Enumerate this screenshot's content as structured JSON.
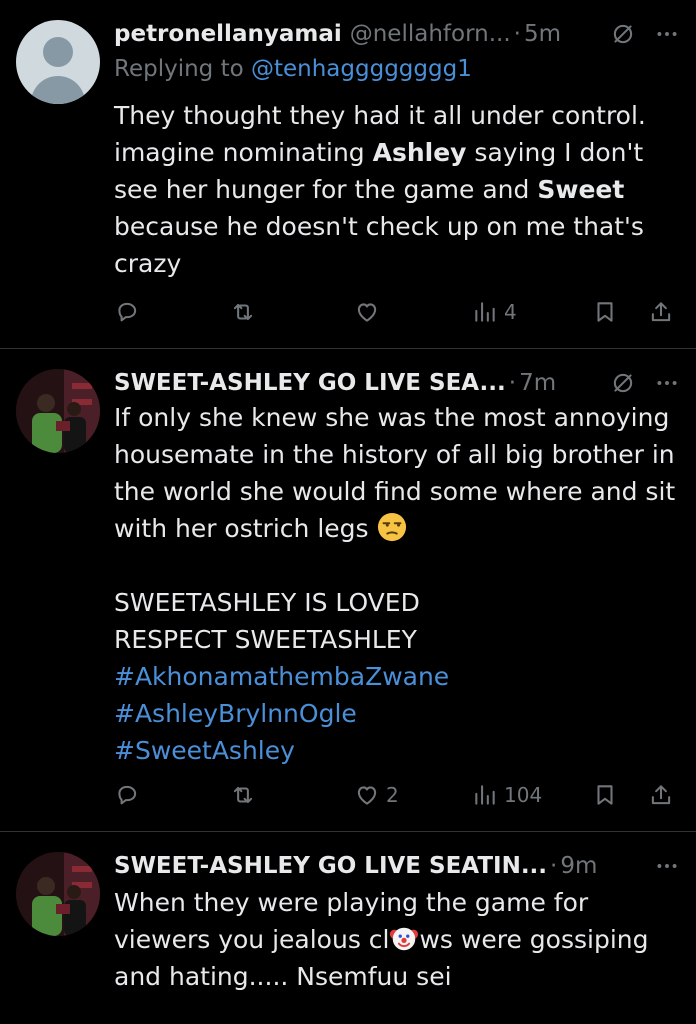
{
  "tweets": [
    {
      "name": "petronellanyamai",
      "handle": "@nellahforn...",
      "time": "5m",
      "reply_prefix": "Replying to",
      "reply_to": "@tenhagggggggg1",
      "lines": [
        {
          "a": "They thought they had it all under control."
        },
        {
          "a": "imagine nominating ",
          "b": "Ashley",
          "c": " saying I don't"
        },
        {
          "a": "see her hunger for the game and ",
          "b": "Sweet"
        },
        {
          "a": "because he doesn't check up on me that's"
        },
        {
          "a": "crazy"
        }
      ],
      "likes": "",
      "views": "4"
    },
    {
      "name": "SWEET-ASHLEY GO LIVE SEA...",
      "time": "7m",
      "lines": [
        "If only she knew she was the most annoying",
        "housemate in the history of all big brother in",
        "the world she would find some where and sit",
        "with her ostrich legs"
      ],
      "emoji": "unamused-face-emoji",
      "caps_lines": [
        "SWEETASHLEY IS LOVED",
        "RESPECT SWEETASHLEY"
      ],
      "hashtags": [
        "#AkhonamathembaZwane",
        "#AshleyBrylnnOgle",
        "#SweetAshley"
      ],
      "likes": "2",
      "views": "104"
    },
    {
      "name": "SWEET-ASHLEY GO LIVE SEATIN...",
      "time": "9m",
      "line1": "When they were playing the game for",
      "line2_a": "viewers you jealous cl",
      "line2_emoji": "clown-face-emoji",
      "line2_b": "ws were  gossiping",
      "line3": "and hating..... Nsemfuu sei"
    }
  ],
  "colors": {
    "background": "#000000",
    "text": "#e7e9ea",
    "muted": "#71767b",
    "link": "#4a8fd8",
    "divider": "#2f3336"
  },
  "icons": [
    "more-icon",
    "grok-icon",
    "reply-icon",
    "retweet-icon",
    "like-icon",
    "views-icon",
    "bookmark-icon",
    "share-icon"
  ]
}
